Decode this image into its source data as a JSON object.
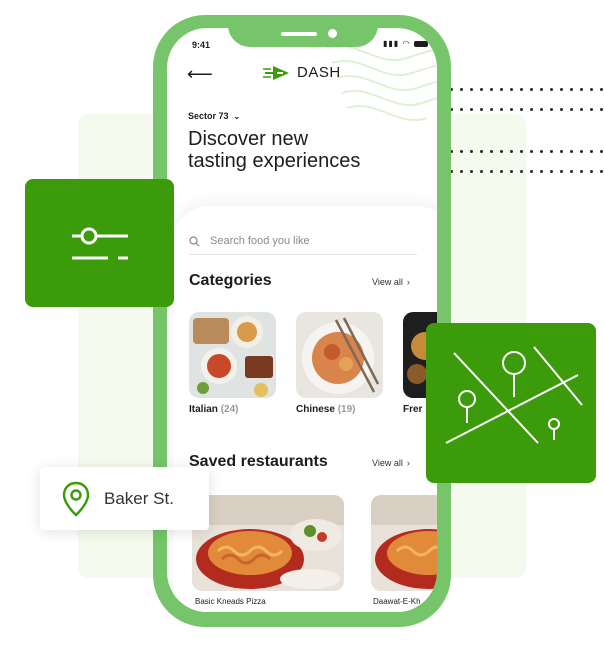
{
  "status": {
    "time": "9:41"
  },
  "brand": {
    "name": "DASH"
  },
  "location": {
    "sector": "Sector 73"
  },
  "headline": {
    "line1": "Discover new",
    "line2": "tasting experiences"
  },
  "search": {
    "placeholder": "Search food you like"
  },
  "categories": {
    "title": "Categories",
    "view_all": "View all",
    "items": [
      {
        "name": "Italian",
        "count": "(24)"
      },
      {
        "name": "Chinese",
        "count": "(19)"
      },
      {
        "name": "Frer",
        "count": ""
      }
    ]
  },
  "saved": {
    "title": "Saved restaurants",
    "view_all": "View all",
    "items": [
      {
        "name": "Basic Kneads Pizza"
      },
      {
        "name": "Daawat-E-Kh"
      }
    ]
  },
  "badge": {
    "address": "Baker St."
  },
  "colors": {
    "phone_frame": "#76c56a",
    "accent_green": "#3b9b0a",
    "background_panel": "#f4fbee"
  }
}
